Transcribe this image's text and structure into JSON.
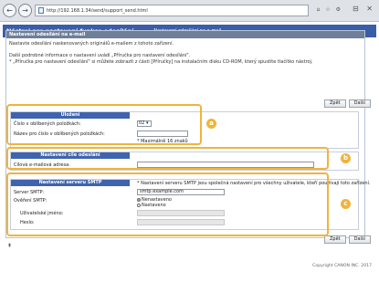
{
  "browser": {
    "url": "http://192.168.1.34/send/support_send.html",
    "nav_back": "←",
    "nav_forward": "→",
    "toolbar_icons": "⌂ ☆ ⚙",
    "window_icons": "⊟ ✕"
  },
  "page": {
    "title": "Nástroj pro nastavení funkce odesílání",
    "subtitle": "Nastavení odesílání na e-mail"
  },
  "panel": {
    "heading": "Nastavení odesílání na e-mail",
    "info": [
      "Nastavte odesílání naskenovaných originálů e-mailem z tohoto zařízení.",
      "",
      "Další podrobné informace o nastavení uvádí „Příručka pro nastavení odesílání\".",
      "* „Příručka pro nastavení odesílání\" si můžete zobrazit z části [Příručky] na instalačním disku CD-ROM, který spustíte tlačítko nástroj."
    ]
  },
  "buttons": {
    "back": "Zpět",
    "next": "Další"
  },
  "sections": {
    "save": {
      "heading": "Uložení",
      "number_label": "Číslo v oblíbených položkách:",
      "number_value": "02",
      "name_label": "Název pro číslo v oblíbených položkách:",
      "name_value": "",
      "max_note": "* Maximálně 16 znaků"
    },
    "destination": {
      "heading": "Nastavení cíle odeslání",
      "email_label": "Cílová e-mailová adresa:",
      "email_value": ""
    },
    "smtp": {
      "heading": "Nastavení serveru SMTP",
      "note": "* Nastavení serveru SMTP jsou společná nastavení pro všechny uživatele, kteří používají toto zařízení.",
      "server_label": "Server SMTP:",
      "server_value": "smtp.example.com",
      "auth_label": "Ověření SMTP:",
      "auth_options": [
        "Nenastaveno",
        "Nastaveno"
      ],
      "auth_selected": "Nenastaveno",
      "user_label": "Uživatelské jméno:",
      "password_label": "Heslo:"
    }
  },
  "badges": [
    "a",
    "b",
    "c"
  ],
  "accent_color": "#f0b43a",
  "header_color": "#3a5da8",
  "footer": {
    "top_link": "⇞",
    "copyright": "Copyright CANON INC. 2017"
  }
}
